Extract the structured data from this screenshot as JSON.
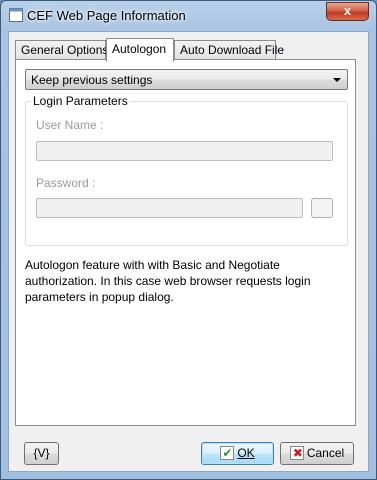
{
  "window": {
    "title": "CEF Web Page Information",
    "close_glyph": "x"
  },
  "tabs": [
    {
      "label": "General Options",
      "active": false
    },
    {
      "label": "Autologon",
      "active": true
    },
    {
      "label": "Auto Download File",
      "active": false
    }
  ],
  "autologon": {
    "mode_selected": "Keep previous settings",
    "group_label": "Login Parameters",
    "username_label": "User Name :",
    "username_value": "",
    "password_label": "Password :",
    "password_value": "",
    "description": "Autologon feature with with Basic and Negotiate authorization. In this case web browser requests login parameters in popup dialog."
  },
  "footer": {
    "variables_button": "{V}",
    "ok_button": "OK",
    "cancel_button": "Cancel"
  },
  "icons": {
    "app": "window-icon",
    "ok": "check-icon",
    "cancel": "x-icon",
    "dropdown": "chevron-down-icon"
  },
  "colors": {
    "titlebar": "#b9d1ea",
    "ok_check": "#1f9c2a",
    "cancel_x": "#d11a1a",
    "close_button": "#c1391f"
  }
}
